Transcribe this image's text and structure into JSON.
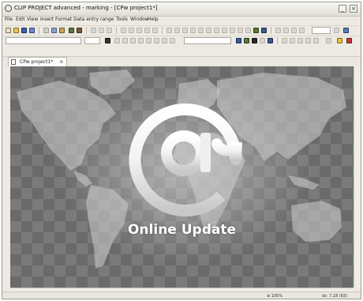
{
  "window": {
    "title": "CLIP PROJECT advanced - marking - [CPw project1*]",
    "minimize_label": "_",
    "close_label": "×"
  },
  "menu": {
    "items": [
      "File",
      "Edit",
      "View",
      "Insert",
      "Format",
      "Data entry range",
      "Tools",
      "Window",
      "Help"
    ]
  },
  "toolbar": {
    "zoom_combo": "100"
  },
  "document": {
    "tab_label": "CPw project1*",
    "tab_close": "⊗"
  },
  "splash": {
    "logo_glyph": "@",
    "caption": "Online Update"
  },
  "status": {
    "zoom": "⊕ 100%",
    "coord": "dz: 7.18 (83)"
  },
  "icons": {
    "app": "app-icon",
    "document": "document-icon",
    "at_logo": "at-sign-icon"
  },
  "colors": {
    "content_background": "#7a7a7a",
    "caption_text": "#ffffff"
  }
}
